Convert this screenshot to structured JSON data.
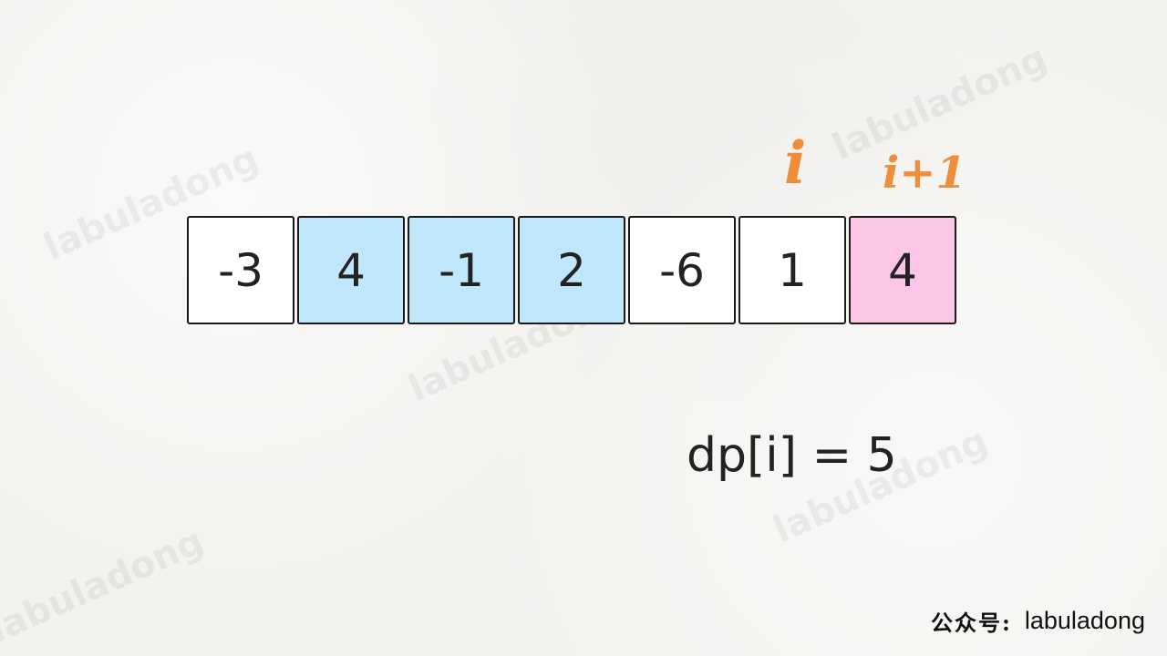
{
  "watermark_text": "labuladong",
  "array": {
    "cells": [
      {
        "value": "-3",
        "color": "#ffffff"
      },
      {
        "value": "4",
        "color": "#bfe6fb"
      },
      {
        "value": "-1",
        "color": "#bfe6fb"
      },
      {
        "value": "2",
        "color": "#bfe6fb"
      },
      {
        "value": "-6",
        "color": "#ffffff"
      },
      {
        "value": "1",
        "color": "#ffffff"
      },
      {
        "value": "4",
        "color": "#fbc6e6"
      }
    ]
  },
  "markers": {
    "i": "i",
    "i_plus_1": "i+1",
    "color": "#ee8d3b"
  },
  "formula": "dp[i] = 5",
  "credit": {
    "label_cn": "公众号:",
    "name": "labuladong"
  }
}
